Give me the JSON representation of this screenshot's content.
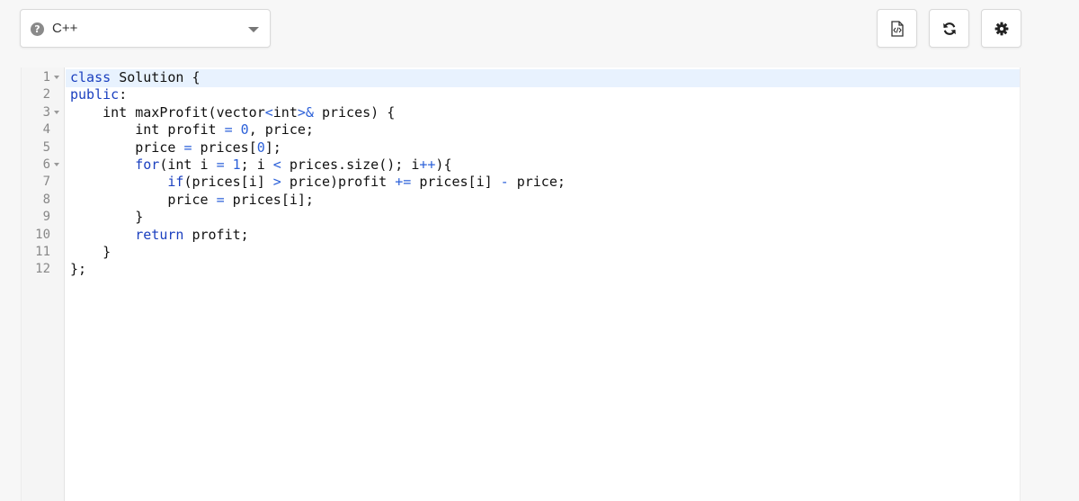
{
  "language_selector": {
    "selected": "C++",
    "icon": "help-circle-icon"
  },
  "toolbar": {
    "buttons": [
      {
        "name": "view-code-file-button",
        "icon": "code-file-icon"
      },
      {
        "name": "reset-button",
        "icon": "refresh-icon"
      },
      {
        "name": "settings-button",
        "icon": "gear-icon"
      }
    ]
  },
  "editor": {
    "line_numbers": [
      "1",
      "2",
      "3",
      "4",
      "5",
      "6",
      "7",
      "8",
      "9",
      "10",
      "11",
      "12"
    ],
    "foldable_lines": [
      1,
      3,
      6
    ],
    "active_line": 1,
    "lines": [
      "class Solution {",
      "public:",
      "    int maxProfit(vector<int>& prices) {",
      "        int profit = 0, price;",
      "        price = prices[0];",
      "        for(int i = 1; i < prices.size(); i++){",
      "            if(prices[i] > price)profit += prices[i] - price;",
      "            price = prices[i];",
      "        }",
      "        return profit;",
      "    }",
      "};"
    ]
  },
  "colors": {
    "keyword": "#1a3fbf",
    "operator": "#2a5fd8",
    "active_line_bg": "#e8f2fe",
    "gutter_bg": "#f5f5f5"
  }
}
